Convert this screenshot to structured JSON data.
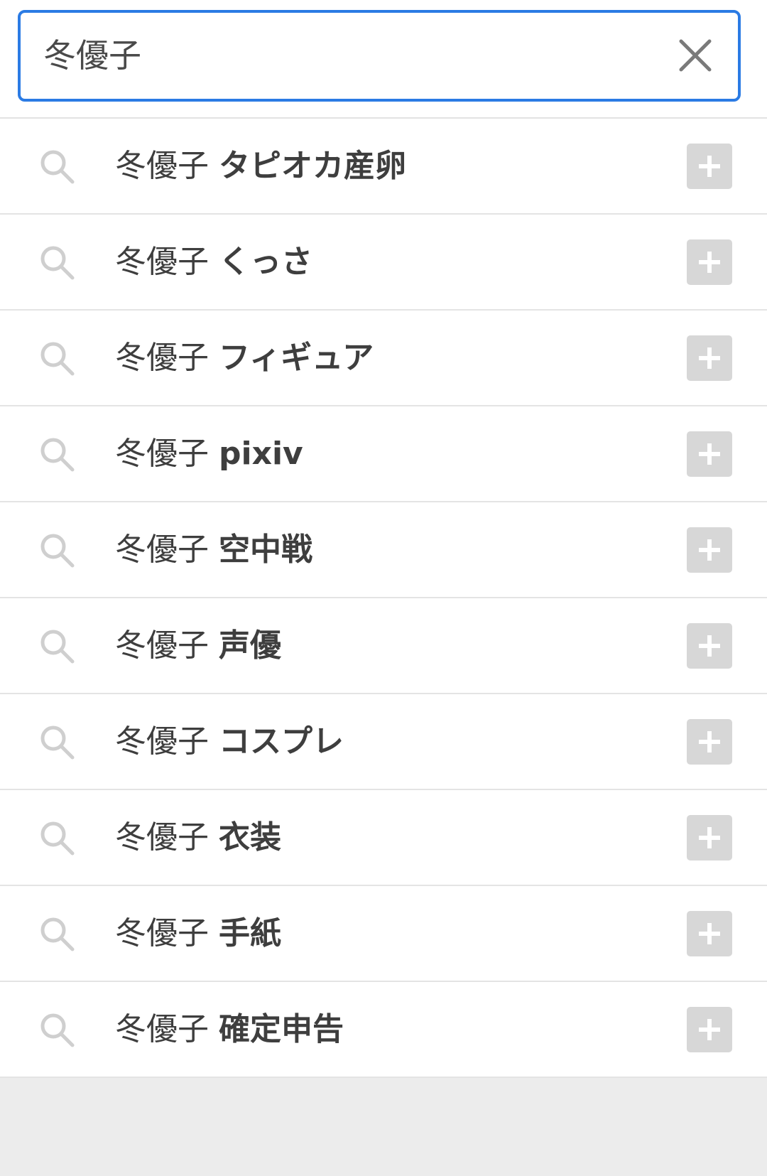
{
  "search": {
    "query": "冬優子",
    "clear_icon": "close-icon"
  },
  "suggestions": [
    {
      "prefix": "冬優子",
      "suffix": "タピオカ産卵",
      "icon": "search-icon",
      "action_icon": "plus-icon"
    },
    {
      "prefix": "冬優子",
      "suffix": "くっさ",
      "icon": "search-icon",
      "action_icon": "plus-icon"
    },
    {
      "prefix": "冬優子",
      "suffix": "フィギュア",
      "icon": "search-icon",
      "action_icon": "plus-icon"
    },
    {
      "prefix": "冬優子",
      "suffix": "pixiv",
      "icon": "search-icon",
      "action_icon": "plus-icon"
    },
    {
      "prefix": "冬優子",
      "suffix": "空中戦",
      "icon": "search-icon",
      "action_icon": "plus-icon"
    },
    {
      "prefix": "冬優子",
      "suffix": "声優",
      "icon": "search-icon",
      "action_icon": "plus-icon"
    },
    {
      "prefix": "冬優子",
      "suffix": "コスプレ",
      "icon": "search-icon",
      "action_icon": "plus-icon"
    },
    {
      "prefix": "冬優子",
      "suffix": "衣装",
      "icon": "search-icon",
      "action_icon": "plus-icon"
    },
    {
      "prefix": "冬優子",
      "suffix": "手紙",
      "icon": "search-icon",
      "action_icon": "plus-icon"
    },
    {
      "prefix": "冬優子",
      "suffix": "確定申告",
      "icon": "search-icon",
      "action_icon": "plus-icon"
    }
  ],
  "colors": {
    "focus_border": "#2b7be4",
    "icon_gray": "#cfcfcf",
    "button_gray": "#d7d7d7",
    "text": "#3e3e3e",
    "background_below": "#ececec"
  }
}
